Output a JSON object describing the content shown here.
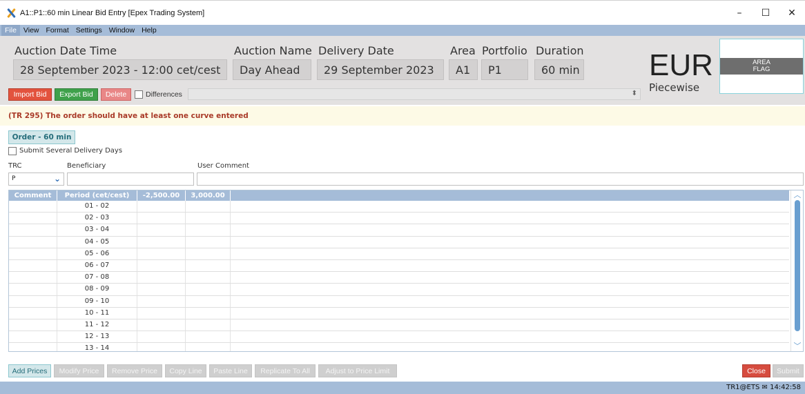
{
  "window": {
    "title": "A1::P1::60 min Linear Bid Entry [Epex Trading System]",
    "controls": {
      "minimize": "–",
      "maximize": "☐",
      "close": "✕"
    }
  },
  "menu": [
    "File",
    "View",
    "Format",
    "Settings",
    "Window",
    "Help"
  ],
  "header": {
    "auction_datetime_label": "Auction Date Time",
    "auction_datetime_value": "28 September 2023 - 12:00 cet/cest",
    "auction_name_label": "Auction Name",
    "auction_name_value": "Day Ahead",
    "delivery_date_label": "Delivery Date",
    "delivery_date_value": "29 September 2023",
    "area_label": "Area",
    "area_value": "A1",
    "portfolio_label": "Portfolio",
    "portfolio_value": "P1",
    "duration_label": "Duration",
    "duration_value": "60 min",
    "currency": "EUR",
    "mode": "Piecewise",
    "area_flag_line1": "AREA",
    "area_flag_line2": "FLAG"
  },
  "toolbar": {
    "import_bid": "Import Bid",
    "export_bid": "Export Bid",
    "delete": "Delete",
    "differences": "Differences"
  },
  "error_message": "(TR 295) The order should have at least one curve entered",
  "order": {
    "tab_label": "Order - 60 min",
    "submit_several_label": "Submit Several Delivery Days",
    "trc_label": "TRC",
    "trc_value": "P",
    "beneficiary_label": "Beneficiary",
    "user_comment_label": "User Comment"
  },
  "grid": {
    "columns": [
      "Comment",
      "Period (cet/cest)",
      "-2,500.00",
      "3,000.00"
    ],
    "rows": [
      "01 - 02",
      "02 - 03",
      "03 - 04",
      "04 - 05",
      "05 - 06",
      "06 - 07",
      "07 - 08",
      "08 - 09",
      "09 - 10",
      "10 - 11",
      "11 - 12",
      "12 - 13",
      "13 - 14"
    ]
  },
  "bottom_buttons": {
    "add_prices": "Add Prices",
    "modify_price": "Modify Price",
    "remove_price": "Remove Price",
    "copy_line": "Copy Line",
    "paste_line": "Paste Line",
    "replicate_to_all": "Replicate To All",
    "adjust_to_price_limit": "Adjust to Price Limit",
    "close": "Close",
    "submit": "Submit"
  },
  "status": {
    "user": "TR1@ETS",
    "time": "14:42:58"
  }
}
